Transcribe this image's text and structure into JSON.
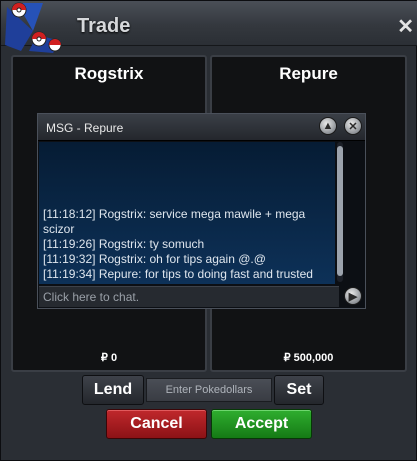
{
  "window": {
    "title": "Trade",
    "close_label": "✕"
  },
  "panels": {
    "left": {
      "name": "Rogstrix",
      "amount": "₽ 0"
    },
    "right": {
      "name": "Repure",
      "amount": "₽ 500,000"
    }
  },
  "chat": {
    "title": "MSG - Repure",
    "messages": [
      "[11:18:12] Rogstrix: service mega mawile + mega scizor",
      "[11:19:26] Rogstrix: ty somuch",
      "[11:19:32] Rogstrix: oh for tips again @.@",
      "[11:19:34] Repure: for tips to doing fast and trusted"
    ],
    "input_placeholder": "Click here to chat.",
    "icons": {
      "collapse": "chevron-up-icon",
      "close": "close-icon",
      "send": "play-icon"
    }
  },
  "controls": {
    "lend_label": "Lend",
    "amount_placeholder": "Enter Pokedollars",
    "set_label": "Set",
    "cancel_label": "Cancel",
    "accept_label": "Accept"
  },
  "colors": {
    "cancel": "#b0201f",
    "accept": "#229422",
    "chat_bg": "#0d3158"
  }
}
